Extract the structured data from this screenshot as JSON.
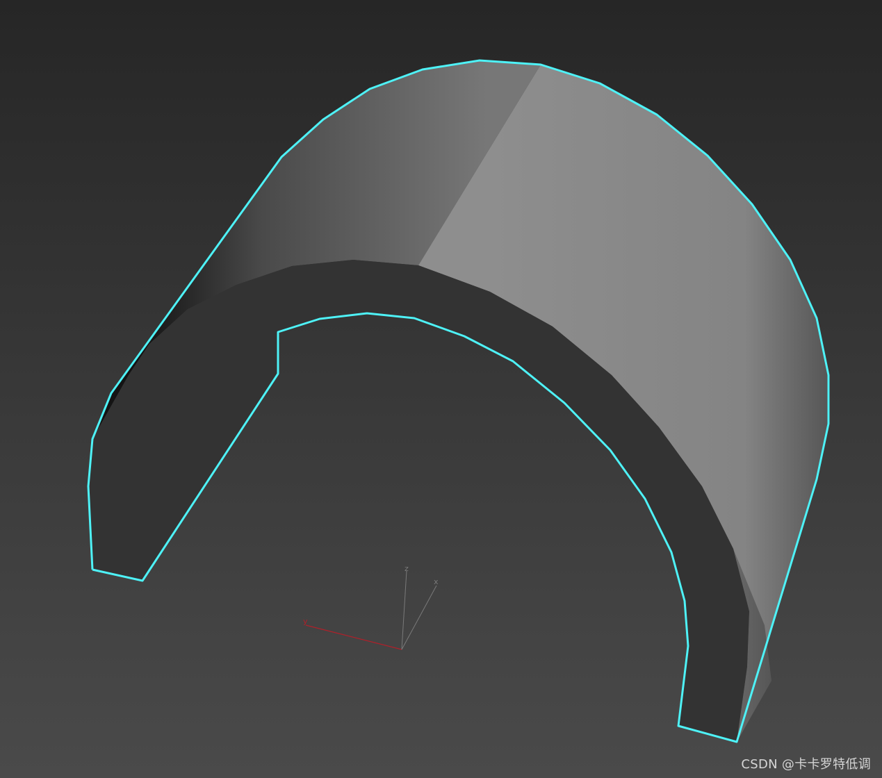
{
  "viewport": {
    "selection_color": "#4ef2f7",
    "object_color": "#8a8a8a"
  },
  "gizmo": {
    "x_label": "x",
    "y_label": "y",
    "z_label": "z",
    "x_color": "#7a7a7a",
    "y_color": "#b0202a",
    "z_color": "#7a7a7a"
  },
  "watermark": {
    "text": "CSDN @卡卡罗特低调"
  }
}
